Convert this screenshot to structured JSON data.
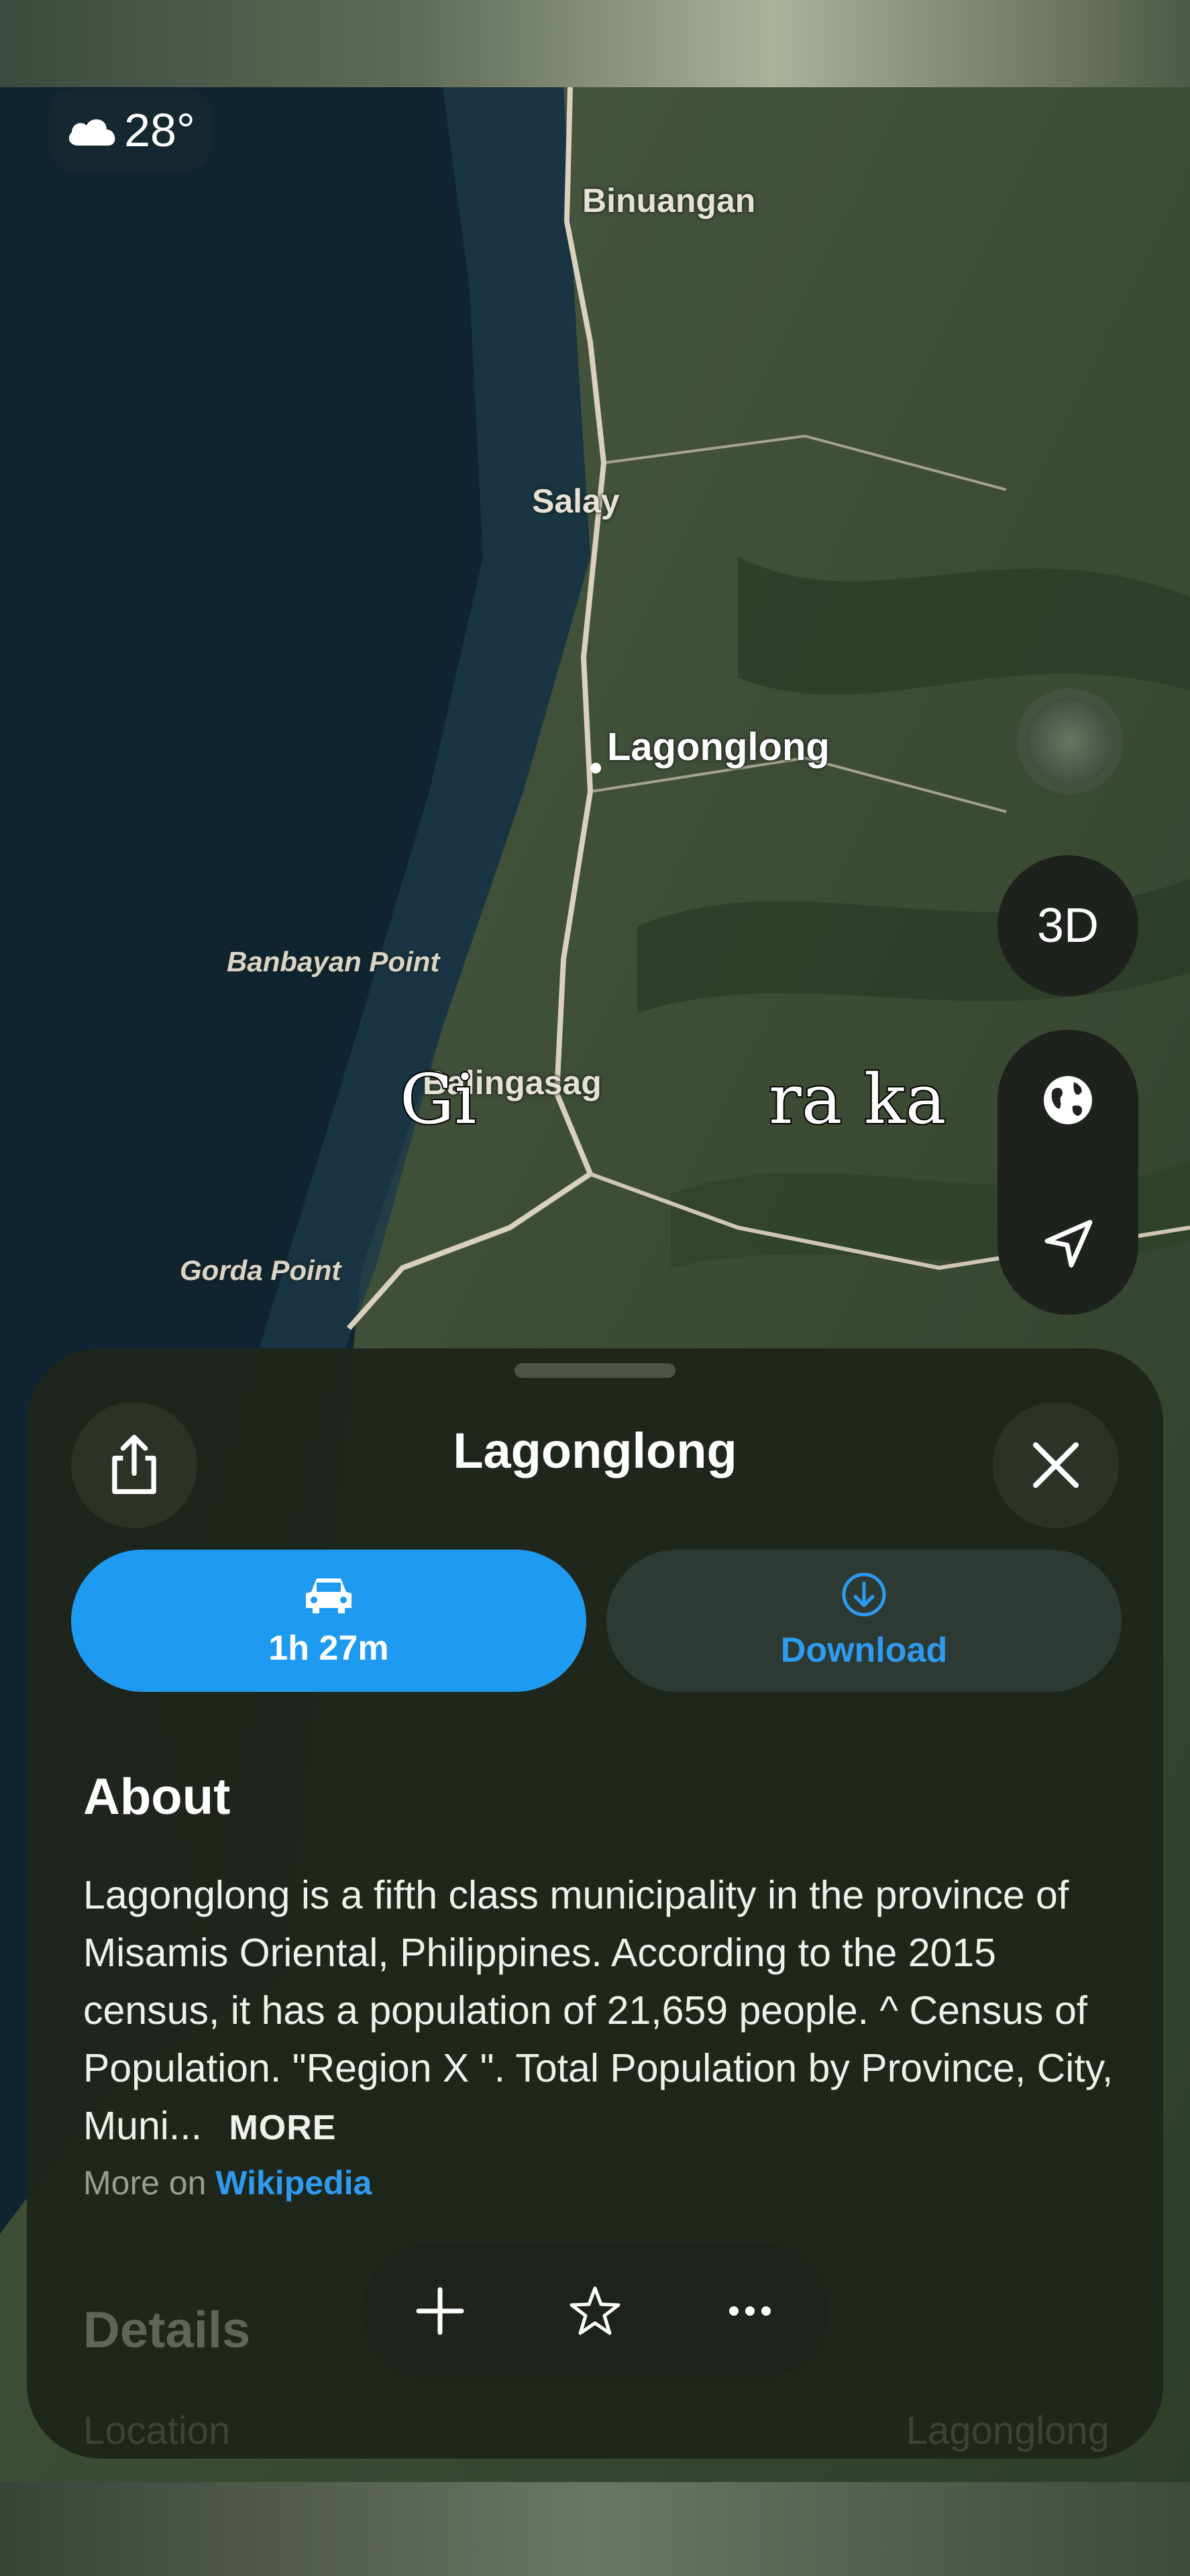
{
  "weather": {
    "icon": "cloud-icon",
    "temperature": "28°"
  },
  "map": {
    "labels": {
      "binuangan": "Binuangan",
      "salay": "Salay",
      "lagonglong": "Lagonglong",
      "banbayan": "Banbayan Point",
      "balingasag": "Balingasag",
      "gorda": "Gorda Point"
    },
    "caption_left": "Gi",
    "caption_right": "ra ka"
  },
  "controls": {
    "view_3d": "3D",
    "globe_icon": "globe-icon",
    "location_icon": "location-arrow-icon"
  },
  "sheet": {
    "title": "Lagonglong",
    "share_icon": "share-icon",
    "close_icon": "close-icon",
    "drive": {
      "icon": "car-icon",
      "label": "1h 27m"
    },
    "download": {
      "icon": "download-icon",
      "label": "Download"
    },
    "about": {
      "heading": "About",
      "text": "Lagonglong is a fifth class municipality in the province of Misamis Oriental, Philippines. According to the 2015 census, it has a population of 21,659 people. ^ Census of Population. \"Region X \". Total Population by Province, City, Muni...",
      "more_label": "MORE",
      "source_prefix": "More on",
      "source_link": "Wikipedia"
    },
    "details": {
      "heading": "Details",
      "location_label": "Location",
      "location_value": "Lagonglong"
    },
    "toolbar": {
      "add_icon": "plus-icon",
      "favorite_icon": "star-icon",
      "more_icon": "ellipsis-icon"
    }
  },
  "colors": {
    "accent": "#1e9bf0",
    "sheet_bg": "#1e251b"
  }
}
